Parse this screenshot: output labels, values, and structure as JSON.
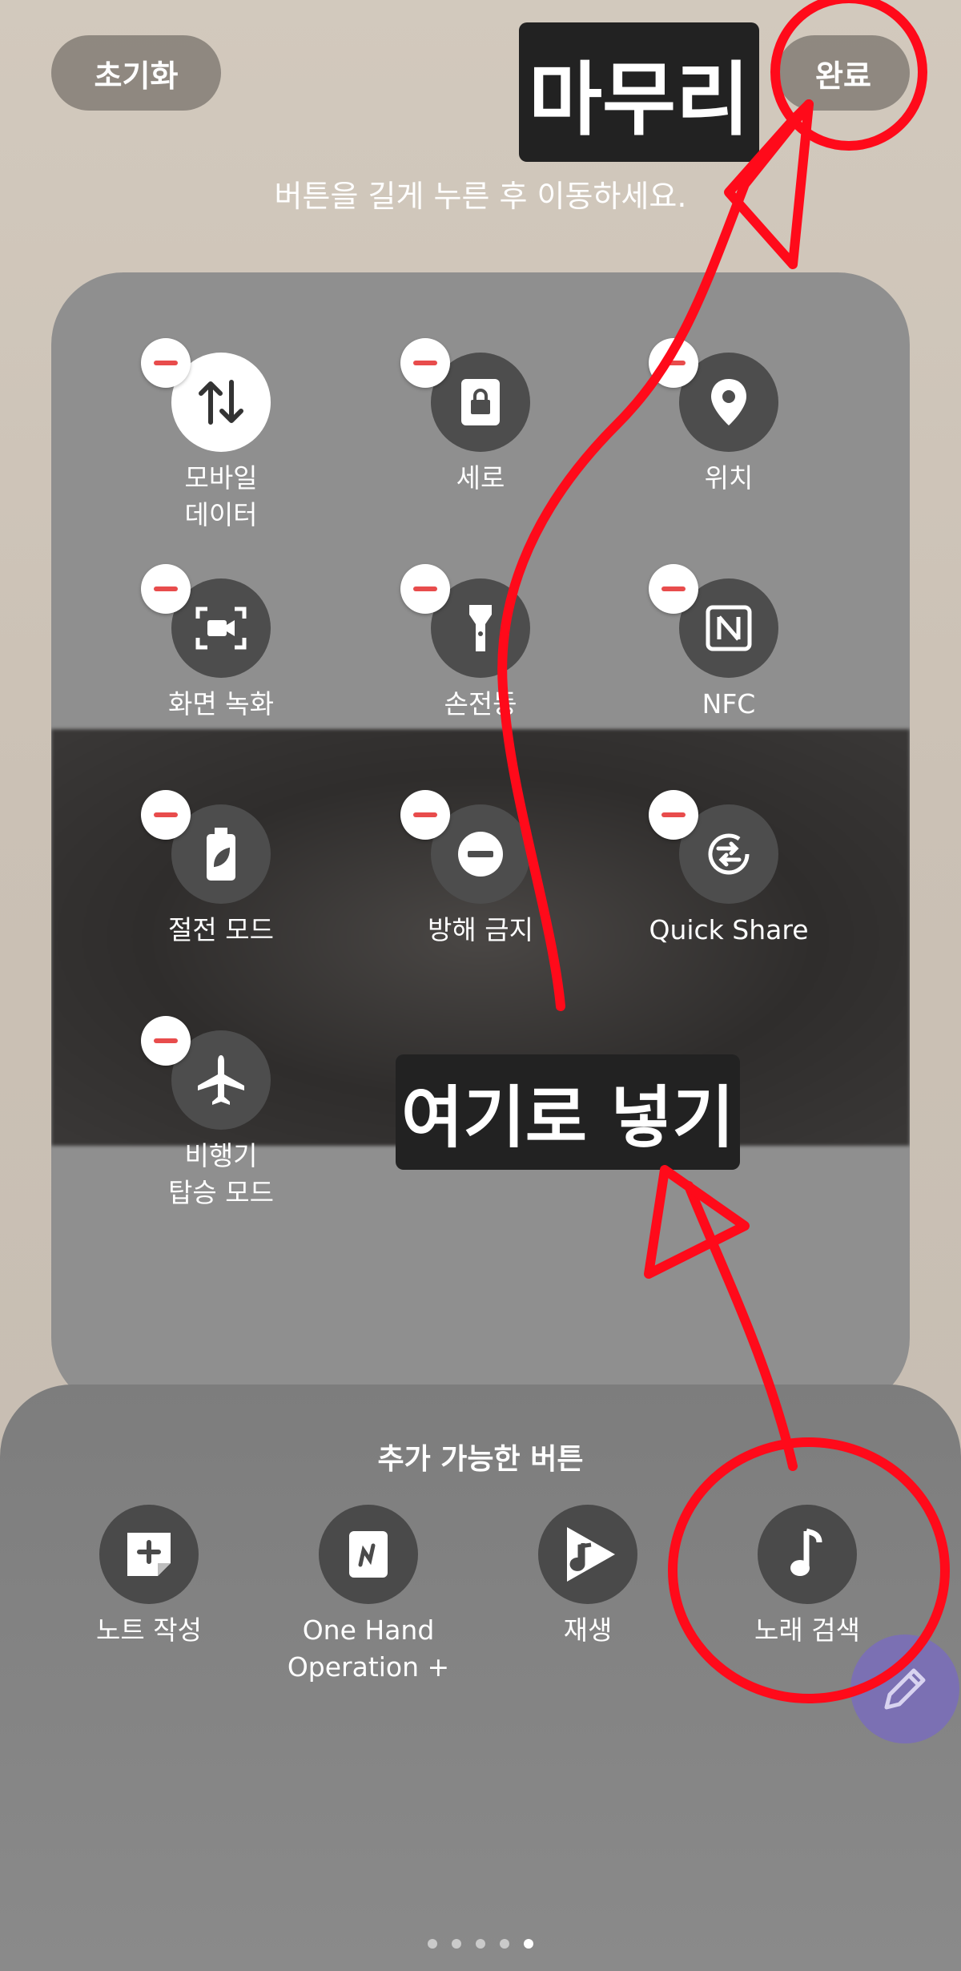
{
  "header": {
    "reset_label": "초기화",
    "done_label": "완료",
    "hint": "버튼을 길게 누른 후 이동하세요."
  },
  "annotations": {
    "finish": "마무리",
    "put_here": "여기로 넣기"
  },
  "active_tiles": [
    {
      "label": "모바일\n데이터",
      "icon": "mobile-data-icon"
    },
    {
      "label": "세로",
      "icon": "lock-rotation-icon"
    },
    {
      "label": "위치",
      "icon": "location-pin-icon"
    },
    {
      "label": "화면 녹화",
      "icon": "screen-record-icon"
    },
    {
      "label": "손전등",
      "icon": "flashlight-icon"
    },
    {
      "label": "NFC",
      "icon": "nfc-icon"
    },
    {
      "label": "절전 모드",
      "icon": "battery-saver-icon"
    },
    {
      "label": "방해 금지",
      "icon": "do-not-disturb-icon"
    },
    {
      "label": "Quick Share",
      "icon": "quick-share-icon"
    },
    {
      "label": "비행기\n탑승 모드",
      "icon": "airplane-icon"
    }
  ],
  "tray": {
    "title": "추가 가능한 버튼",
    "items": [
      {
        "label": "노트 작성",
        "icon": "note-add-icon"
      },
      {
        "label": "One Hand\nOperation +",
        "icon": "one-hand-icon"
      },
      {
        "label": "재생",
        "icon": "play-icon"
      },
      {
        "label": "노래 검색",
        "icon": "music-note-icon"
      }
    ]
  },
  "fab": {
    "icon": "pencil-icon"
  },
  "pagination": {
    "total": 5,
    "current": 5
  },
  "colors": {
    "annotation": "#ff0a1a",
    "minus": "#e84c4c",
    "fab": "#7b70b3"
  }
}
